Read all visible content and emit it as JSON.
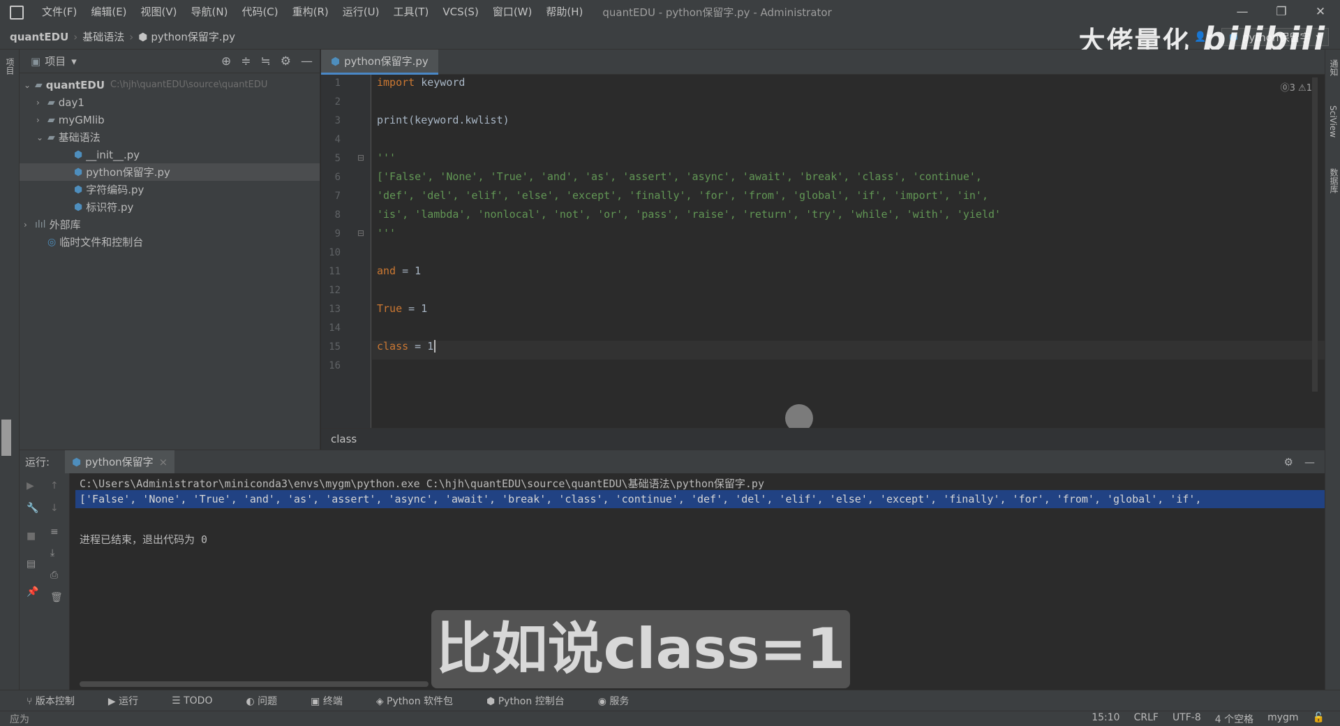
{
  "menu": [
    "文件(F)",
    "编辑(E)",
    "视图(V)",
    "导航(N)",
    "代码(C)",
    "重构(R)",
    "运行(U)",
    "工具(T)",
    "VCS(S)",
    "窗口(W)",
    "帮助(H)"
  ],
  "window_title": "quantEDU - python保留字.py - Administrator",
  "breadcrumb": [
    "quantEDU",
    "基础语法",
    "python保留字.py"
  ],
  "run_config": "python保留字",
  "watermark": {
    "text": "大佬量化",
    "logo": "bilibili"
  },
  "left_strip_label": "项目",
  "right_strip_labels": [
    "通知",
    "SciView",
    "数据库"
  ],
  "project_panel": {
    "title": "项目",
    "root": {
      "name": "quantEDU",
      "path": "C:\\hjh\\quantEDU\\source\\quantEDU"
    },
    "items": [
      "day1",
      "myGMlib",
      "基础语法",
      "__init__.py",
      "python保留字.py",
      "字符编码.py",
      "标识符.py",
      "外部库",
      "临时文件和控制台"
    ]
  },
  "editor": {
    "tab": "python保留字.py",
    "inspections": "⓪3  ⚠1",
    "line_numbers": [
      "1",
      "2",
      "3",
      "4",
      "5",
      "6",
      "7",
      "8",
      "9",
      "10",
      "11",
      "12",
      "13",
      "14",
      "15",
      "16"
    ],
    "lines": {
      "l1a": "import",
      "l1b": " keyword",
      "l3": "print(keyword.kwlist)",
      "l5": "'''",
      "l6": "['False', 'None', 'True', 'and', 'as', 'assert', 'async', 'await', 'break', 'class', 'continue',",
      "l7": "'def', 'del', 'elif', 'else', 'except', 'finally', 'for', 'from', 'global', 'if', 'import', 'in',",
      "l8": "'is', 'lambda', 'nonlocal', 'not', 'or', 'pass', 'raise', 'return', 'try', 'while', 'with', 'yield'",
      "l9": "'''",
      "l11a": "and",
      "l11b": " = 1",
      "l13a": "True",
      "l13b": " = 1",
      "l15a": "class",
      "l15b": " = 1"
    },
    "breadcrumb": "class"
  },
  "run": {
    "label": "运行:",
    "tab": "python保留字",
    "cmd": "C:\\Users\\Administrator\\miniconda3\\envs\\mygm\\python.exe C:\\hjh\\quantEDU\\source\\quantEDU\\基础语法\\python保留字.py",
    "output": "['False', 'None', 'True', 'and', 'as', 'assert', 'async', 'await', 'break', 'class', 'continue', 'def', 'del', 'elif', 'else', 'except', 'finally', 'for', 'from', 'global', 'if',",
    "exit": "进程已结束，退出代码为 0"
  },
  "subtitle": "比如说class=1",
  "bottom_tools": [
    "版本控制",
    "运行",
    "TODO",
    "问题",
    "终端",
    "Python 软件包",
    "Python 控制台",
    "服务"
  ],
  "status": {
    "left": "应为",
    "pos": "15:10",
    "eol": "CRLF",
    "enc": "UTF-8",
    "indent": "4 个空格",
    "interp": "mygm"
  }
}
